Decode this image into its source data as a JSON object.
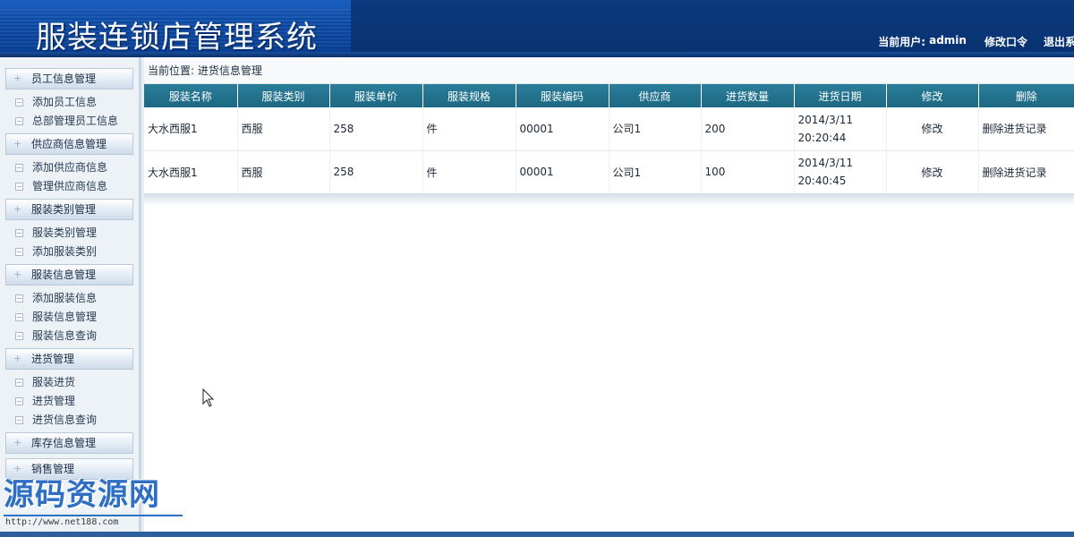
{
  "header": {
    "title": "服装连锁店管理系统",
    "user_label": "当前用户:",
    "user_name": "admin",
    "change_password": "修改口令",
    "logout": "退出系统"
  },
  "sidebar": {
    "groups": [
      {
        "label": "员工信息管理",
        "items": [
          "添加员工信息",
          "总部管理员工信息"
        ]
      },
      {
        "label": "供应商信息管理",
        "items": [
          "添加供应商信息",
          "管理供应商信息"
        ]
      },
      {
        "label": "服装类别管理",
        "items": [
          "服装类别管理",
          "添加服装类别"
        ]
      },
      {
        "label": "服装信息管理",
        "items": [
          "添加服装信息",
          "服装信息管理",
          "服装信息查询"
        ]
      },
      {
        "label": "进货管理",
        "items": [
          "服装进货",
          "进货管理",
          "进货信息查询"
        ]
      },
      {
        "label": "库存信息管理",
        "items": []
      },
      {
        "label": "销售管理",
        "items": []
      }
    ]
  },
  "breadcrumb": "当前位置: 进货信息管理",
  "table": {
    "columns": [
      "服装名称",
      "服装类别",
      "服装单价",
      "服装规格",
      "服装编码",
      "供应商",
      "进货数量",
      "进货日期",
      "修改",
      "删除"
    ],
    "rows": [
      {
        "name": "大水西服1",
        "category": "西服",
        "price": "258",
        "spec": "件",
        "code": "00001",
        "supplier": "公司1",
        "qty": "200",
        "date": "2014/3/11",
        "time": "20:20:44",
        "edit": "修改",
        "delete": "删除进货记录"
      },
      {
        "name": "大水西服1",
        "category": "西服",
        "price": "258",
        "spec": "件",
        "code": "00001",
        "supplier": "公司1",
        "qty": "100",
        "date": "2014/3/11",
        "time": "20:40:45",
        "edit": "修改",
        "delete": "删除进货记录"
      }
    ]
  },
  "watermark": {
    "text": "源码资源网",
    "url": "http://www.net188.com"
  },
  "colors": {
    "header_bg": "#0c3d86",
    "table_header": "#1d6882",
    "watermark": "#2e6fc4"
  }
}
